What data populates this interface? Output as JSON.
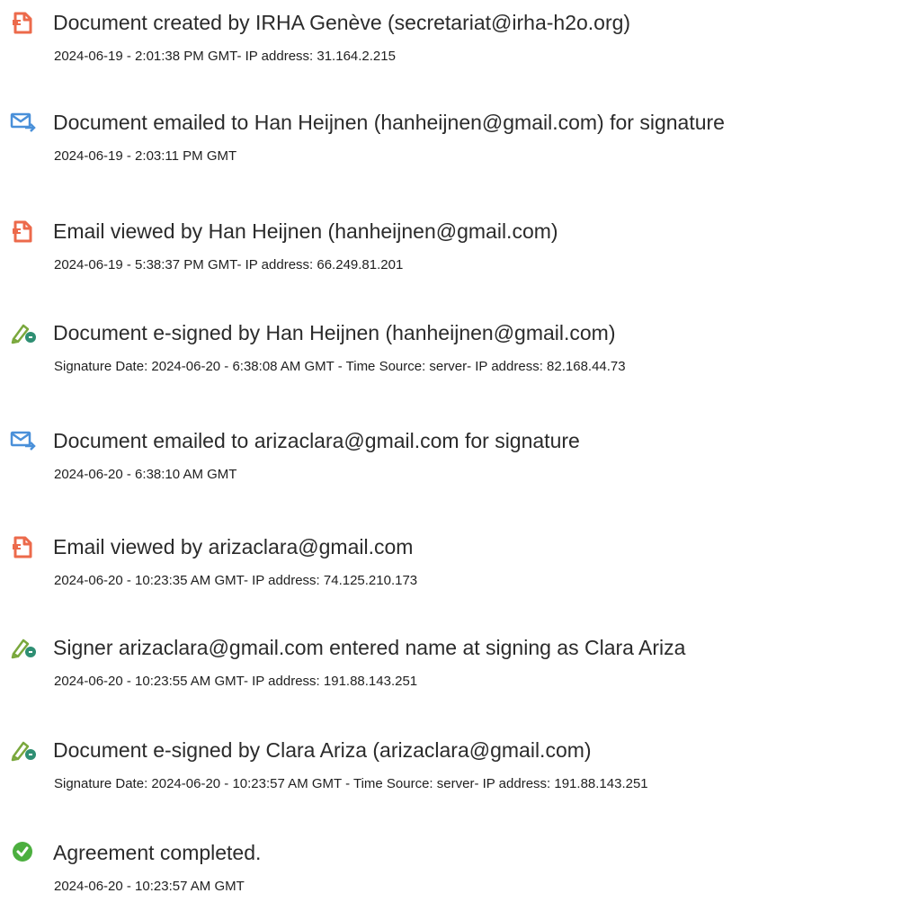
{
  "events": [
    {
      "icon": "document-created-icon",
      "title": "Document created by IRHA Genève (secretariat@irha-h2o.org)",
      "detail": "2024-06-19 - 2:01:38 PM GMT- IP address: 31.164.2.215"
    },
    {
      "icon": "email-sent-icon",
      "title": "Document emailed to Han Heijnen (hanheijnen@gmail.com) for signature",
      "detail": "2024-06-19 - 2:03:11 PM GMT"
    },
    {
      "icon": "document-viewed-icon",
      "title": "Email viewed by Han Heijnen (hanheijnen@gmail.com)",
      "detail": "2024-06-19 - 5:38:37 PM GMT- IP address: 66.249.81.201"
    },
    {
      "icon": "e-sign-pen-icon",
      "title": "Document e-signed by Han Heijnen (hanheijnen@gmail.com)",
      "detail": "Signature Date: 2024-06-20 - 6:38:08 AM GMT - Time Source: server- IP address: 82.168.44.73"
    },
    {
      "icon": "email-sent-icon",
      "title": "Document emailed to arizaclara@gmail.com for signature",
      "detail": "2024-06-20 - 6:38:10 AM GMT"
    },
    {
      "icon": "document-viewed-icon",
      "title": "Email viewed by arizaclara@gmail.com",
      "detail": "2024-06-20 - 10:23:35 AM GMT- IP address: 74.125.210.173"
    },
    {
      "icon": "e-sign-pen-icon",
      "title": "Signer arizaclara@gmail.com entered name at signing as Clara Ariza",
      "detail": "2024-06-20 - 10:23:55 AM GMT- IP address: 191.88.143.251"
    },
    {
      "icon": "e-sign-pen-icon",
      "title": "Document e-signed by Clara Ariza (arizaclara@gmail.com)",
      "detail": "Signature Date: 2024-06-20 - 10:23:57 AM GMT - Time Source: server- IP address: 191.88.143.251"
    },
    {
      "icon": "check-circle-icon",
      "title": "Agreement completed.",
      "detail": "2024-06-20 - 10:23:57 AM GMT"
    }
  ],
  "colors": {
    "document_icon": "#ec6a4b",
    "email_icon": "#4a90d9",
    "pen_icon": "#7aa83d",
    "check_icon": "#4caf3f"
  }
}
